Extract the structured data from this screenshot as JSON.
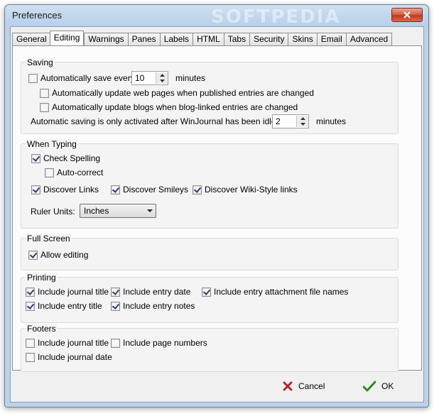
{
  "window": {
    "title": "Preferences",
    "watermark": "SOFTPEDIA"
  },
  "tabs": [
    "General",
    "Editing",
    "Warnings",
    "Panes",
    "Labels",
    "HTML",
    "Tabs",
    "Security",
    "Skins",
    "Email",
    "Advanced"
  ],
  "active_tab": "Editing",
  "saving": {
    "label": "Saving",
    "auto_save_label": "Automatically save every",
    "auto_save_checked": false,
    "auto_save_value": "10",
    "auto_save_unit": "minutes",
    "update_web_label": "Automatically update web pages when published entries are changed",
    "update_web_checked": false,
    "update_blogs_label": "Automatically update blogs when blog-linked entries are changed",
    "update_blogs_checked": false,
    "idle_label": "Automatic saving  is only activated after WinJournal has been idle for :",
    "idle_value": "2",
    "idle_unit": "minutes"
  },
  "when_typing": {
    "label": "When Typing",
    "check_spelling": "Check Spelling",
    "check_spelling_checked": true,
    "auto_correct": "Auto-correct",
    "auto_correct_checked": false,
    "discover_links": "Discover Links",
    "discover_links_checked": true,
    "discover_smileys": "Discover Smileys",
    "discover_smileys_checked": true,
    "discover_wiki": "Discover Wiki-Style links",
    "discover_wiki_checked": true,
    "ruler_label": "Ruler Units:",
    "ruler_value": "Inches"
  },
  "full_screen": {
    "label": "Full Screen",
    "allow_editing": "Allow editing",
    "allow_editing_checked": true
  },
  "printing": {
    "label": "Printing",
    "journal_title": "Include journal title",
    "journal_title_checked": true,
    "entry_date": "Include entry date",
    "entry_date_checked": true,
    "attachment_names": "Include entry attachment file names",
    "attachment_names_checked": true,
    "entry_title": "Include entry title",
    "entry_title_checked": true,
    "entry_notes": "Include entry notes",
    "entry_notes_checked": true
  },
  "footers": {
    "label": "Footers",
    "journal_title": "Include journal title",
    "journal_title_checked": false,
    "page_numbers": "Include page numbers",
    "page_numbers_checked": false,
    "journal_date": "Include journal date",
    "journal_date_checked": false
  },
  "buttons": {
    "cancel": "Cancel",
    "ok": "OK"
  },
  "colors": {
    "cancel_icon": "#b3262a",
    "ok_icon": "#2e8b1e"
  }
}
